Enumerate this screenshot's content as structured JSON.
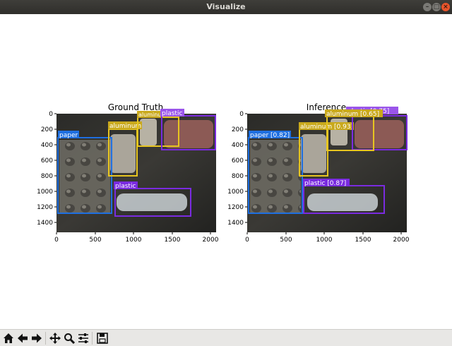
{
  "window": {
    "title": "Visualize"
  },
  "figure": {
    "panels": [
      {
        "title": "Ground Truth",
        "boxes": [
          {
            "label": "paper",
            "color": "#1f6fe0"
          },
          {
            "label": "aluminum",
            "color": "#e7c520"
          },
          {
            "label": "aluminum",
            "color": "#e7c520"
          },
          {
            "label": "plastic",
            "color": "#7a2be0"
          },
          {
            "label": "plastic",
            "color": "#7a2be0"
          }
        ]
      },
      {
        "title": "Inference",
        "boxes": [
          {
            "label": "paper [0.82]",
            "color": "#1f6fe0"
          },
          {
            "label": "aluminum [0.93]",
            "color": "#e7c520"
          },
          {
            "label": "aluminum [0.65]",
            "color": "#e7c520"
          },
          {
            "label": "plastic [0.75]",
            "color": "#7a2be0"
          },
          {
            "label": "plastic [0.87]",
            "color": "#7a2be0"
          }
        ]
      }
    ],
    "x_ticks": [
      "0",
      "500",
      "1000",
      "1500",
      "2000"
    ],
    "y_ticks": [
      "0",
      "200",
      "400",
      "600",
      "800",
      "1000",
      "1200",
      "1400"
    ]
  },
  "toolbar": {
    "buttons": [
      "home-icon",
      "back-icon",
      "forward-icon",
      "pan-icon",
      "zoom-icon",
      "configure-icon",
      "save-icon"
    ]
  }
}
